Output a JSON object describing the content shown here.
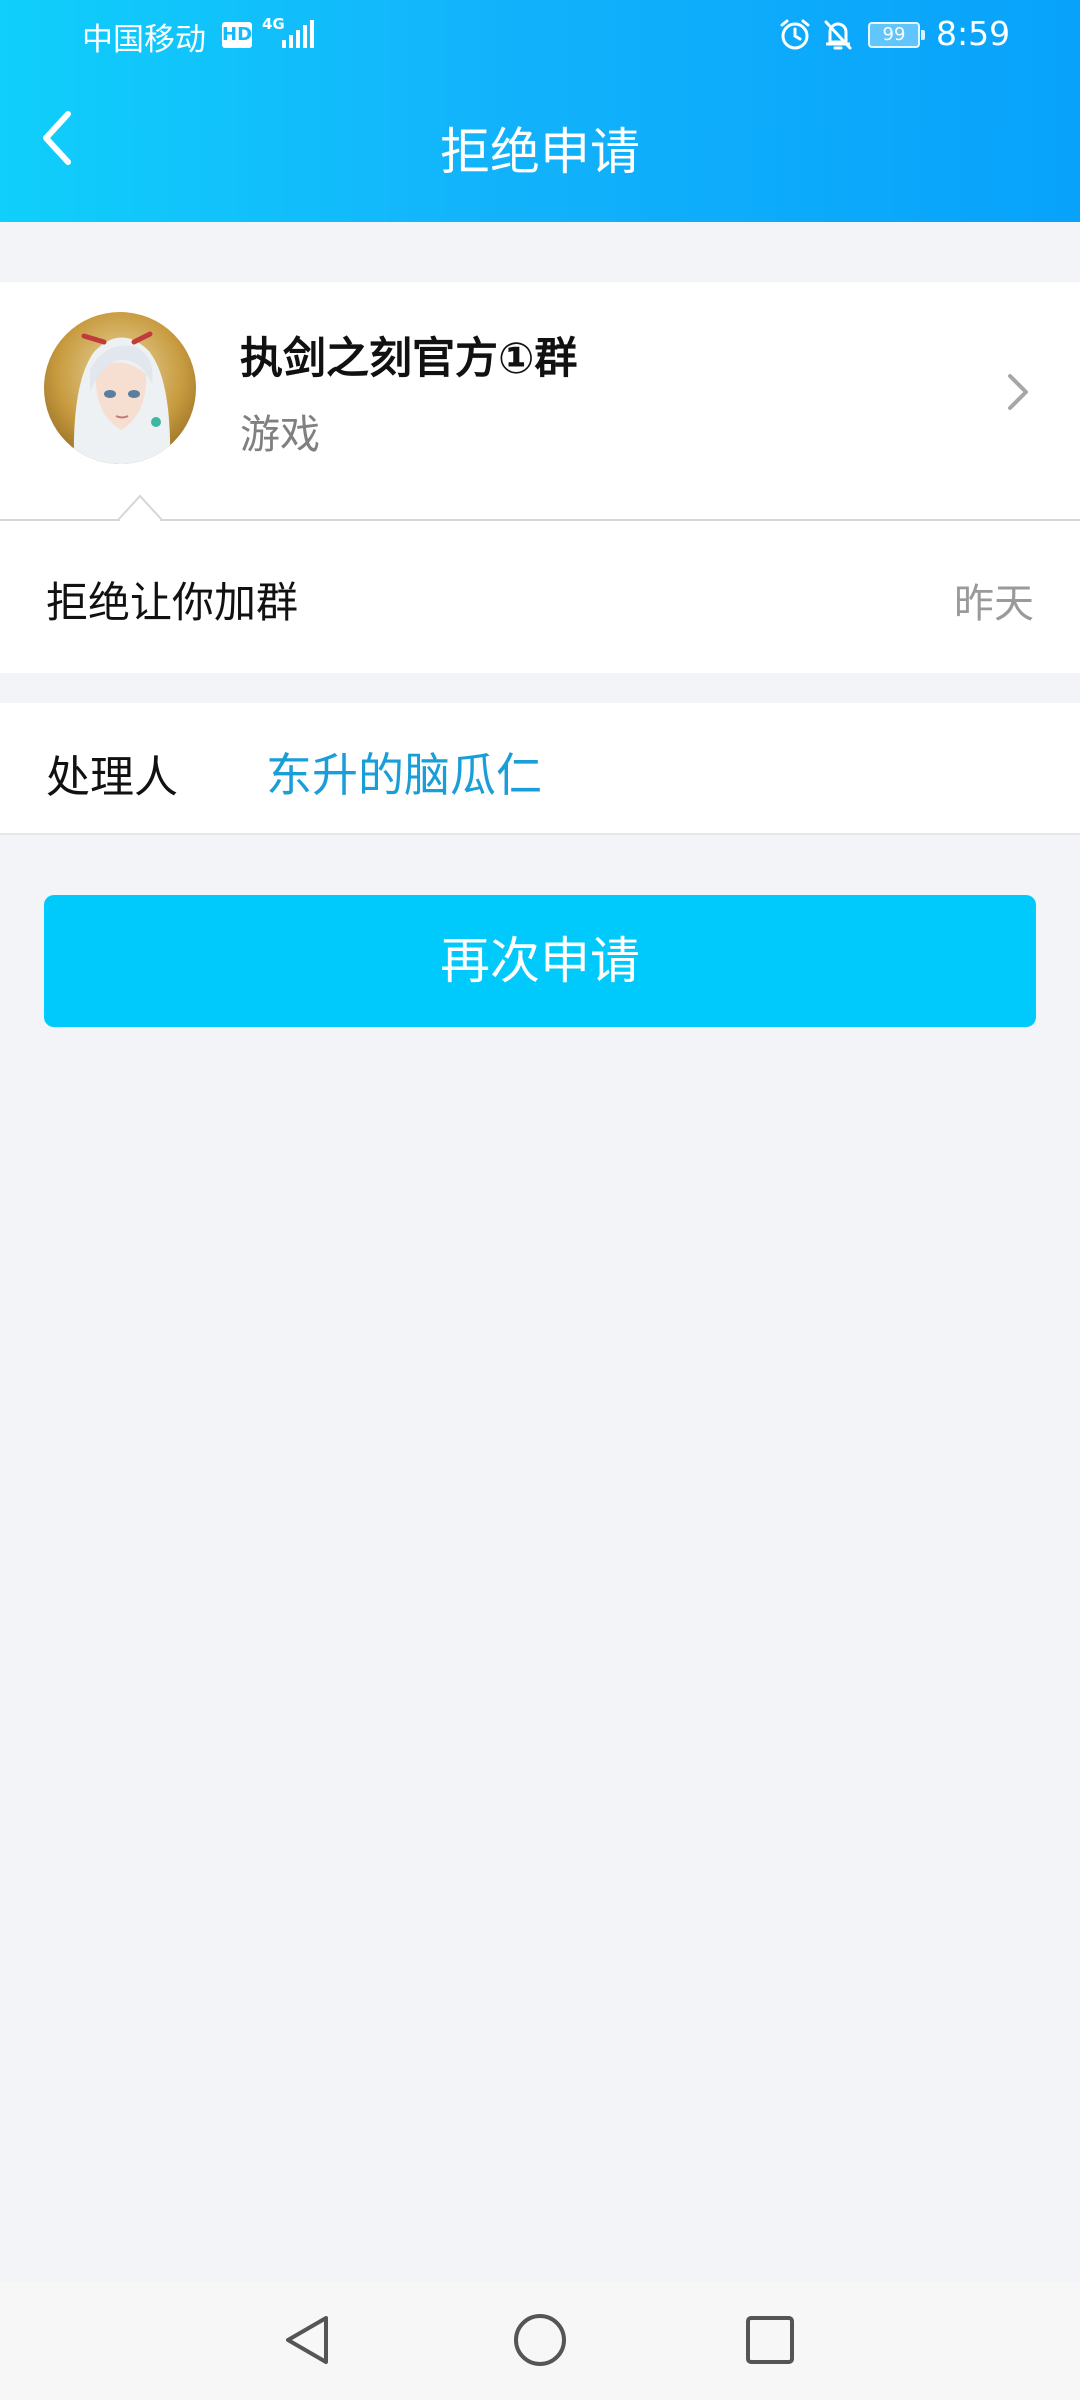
{
  "status_bar": {
    "carrier": "中国移动",
    "hd_badge": "HD",
    "network_type": "4G",
    "battery_level": "99",
    "time": "8:59"
  },
  "header": {
    "title": "拒绝申请",
    "back_icon": "chevron-left-icon"
  },
  "group": {
    "name": "执剑之刻官方①群",
    "category": "游戏",
    "avatar_icon": "group-avatar",
    "chevron_icon": "chevron-right-icon"
  },
  "rejection": {
    "message": "拒绝让你加群",
    "time": "昨天"
  },
  "handler": {
    "label": "处理人",
    "name": "东升的脑瓜仁"
  },
  "actions": {
    "reapply_label": "再次申请"
  },
  "colors": {
    "header_gradient_start": "#10cffb",
    "header_gradient_end": "#08a2fb",
    "button_bg": "#00cafc",
    "link_color": "#1a9ed8",
    "page_bg": "#f3f4f8"
  },
  "nav_bar": {
    "back_icon": "triangle-back-icon",
    "home_icon": "circle-home-icon",
    "recent_icon": "square-recent-icon"
  }
}
